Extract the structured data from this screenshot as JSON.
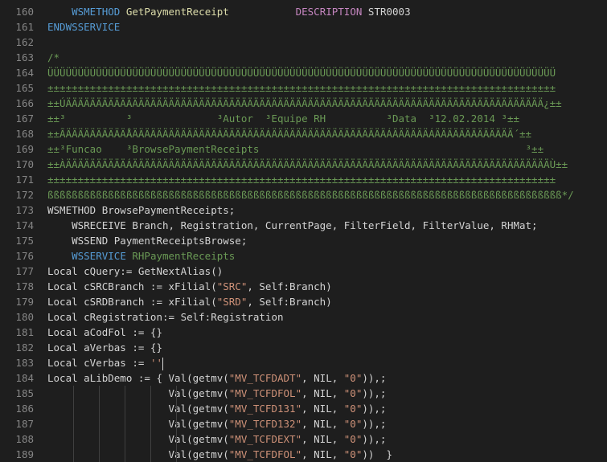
{
  "editor": {
    "colors": {
      "background": "#1e1e1e",
      "line_number": "#858585",
      "keyword": "#569cd6",
      "function": "#dcdcaa",
      "macro": "#c586c0",
      "comment": "#6a9955",
      "string": "#ce9178",
      "number": "#b5cea8",
      "text": "#d4d4d4"
    },
    "lines": [
      {
        "num": "160",
        "tokens": [
          {
            "t": "    ",
            "c": "plain"
          },
          {
            "t": "WSMETHOD",
            "c": "kw"
          },
          {
            "t": " ",
            "c": "plain"
          },
          {
            "t": "GetPaymentReceipt",
            "c": "fn"
          },
          {
            "t": "           ",
            "c": "plain"
          },
          {
            "t": "DESCRIPTION",
            "c": "macro"
          },
          {
            "t": " STR0003",
            "c": "plain"
          }
        ]
      },
      {
        "num": "161",
        "tokens": [
          {
            "t": "ENDWSSERVICE",
            "c": "kw"
          }
        ]
      },
      {
        "num": "162",
        "tokens": []
      },
      {
        "num": "163",
        "tokens": [
          {
            "t": "/*",
            "c": "cm"
          }
        ]
      },
      {
        "num": "164",
        "tokens": [
          {
            "t": "ÜÜÜÜÜÜÜÜÜÜÜÜÜÜÜÜÜÜÜÜÜÜÜÜÜÜÜÜÜÜÜÜÜÜÜÜÜÜÜÜÜÜÜÜÜÜÜÜÜÜÜÜÜÜÜÜÜÜÜÜÜÜÜÜÜÜÜÜÜÜÜÜÜÜÜÜÜÜÜÜÜÜÜÜ",
            "c": "cm"
          }
        ]
      },
      {
        "num": "165",
        "tokens": [
          {
            "t": "±±±±±±±±±±±±±±±±±±±±±±±±±±±±±±±±±±±±±±±±±±±±±±±±±±±±±±±±±±±±±±±±±±±±±±±±±±±±±±±±±±±±",
            "c": "cm"
          }
        ]
      },
      {
        "num": "166",
        "tokens": [
          {
            "t": "±±ÚÄÄÄÄÄÄÄÄÄÄÄÄÄÄÄÄÄÄÄÄÄÄÄÄÄÄÄÄÄÄÄÄÄÄÄÄÄÄÄÄÄÄÄÄÄÄÄÄÄÄÄÄÄÄÄÄÄÄÄÄÄÄÄÄÄÄÄÄÄÄÄÄÄÄÄÄÄÄÄ¿±±",
            "c": "cm"
          }
        ]
      },
      {
        "num": "167",
        "tokens": [
          {
            "t": "±±³          ³              ³Autor  ³Equipe RH          ³Data  ³12.02.2014 ³±±",
            "c": "cm"
          }
        ]
      },
      {
        "num": "168",
        "tokens": [
          {
            "t": "±±ÃÄÄÄÄÄÄÄÄÄÄÅÄÄÄÄÄÄÄÄÄÄÄÄÄÄÁÄÄÄÄÄÄÄÁÄÄÄÄÄÄÄÄÄÄÄÄÄÄÄÄÄÄÄÁÄÄÄÄÄÄÁÄÄÄÄÄÄÄÄÄÄÄÄÄ´±±",
            "c": "cm"
          }
        ]
      },
      {
        "num": "169",
        "tokens": [
          {
            "t": "±±³Funcao    ³BrowsePaymentReceipts                                            ³±±",
            "c": "cm"
          }
        ]
      },
      {
        "num": "170",
        "tokens": [
          {
            "t": "±±ÀÄÄÄÄÄÄÄÄÄÄÁÄÄÄÄÄÄÄÄÄÄÄÄÄÄÄÄÄÄÄÄÄÄÄÄÄÄÄÄÄÄÄÄÄÄÄÄÄÄÄÄÄÄÄÄÄÄÄÄÄÄÄÄÄÄÄÄÄÄÄÄÄÄÄÄÄÄÄÄÄÙ±±",
            "c": "cm"
          }
        ]
      },
      {
        "num": "171",
        "tokens": [
          {
            "t": "±±±±±±±±±±±±±±±±±±±±±±±±±±±±±±±±±±±±±±±±±±±±±±±±±±±±±±±±±±±±±±±±±±±±±±±±±±±±±±±±±±±±",
            "c": "cm"
          }
        ]
      },
      {
        "num": "172",
        "tokens": [
          {
            "t": "ßßßßßßßßßßßßßßßßßßßßßßßßßßßßßßßßßßßßßßßßßßßßßßßßßßßßßßßßßßßßßßßßßßßßßßßßßßßßßßßßßßßßß*/",
            "c": "cm"
          }
        ]
      },
      {
        "num": "173",
        "tokens": [
          {
            "t": "WSMETHOD BrowsePaymentReceipts;",
            "c": "plain"
          }
        ]
      },
      {
        "num": "174",
        "tokens": [
          {
            "t": "    WSRECEIVE Branch, Registration, CurrentPage, FilterField, FilterValue, RHMat;",
            "c": "plain"
          }
        ]
      },
      {
        "num": "175",
        "tokens": [
          {
            "t": "    WSSEND PaymentReceiptsBrowse;",
            "c": "plain"
          }
        ]
      },
      {
        "num": "176",
        "tokens": [
          {
            "t": "    ",
            "c": "plain"
          },
          {
            "t": "WSSERVICE",
            "c": "kw"
          },
          {
            "t": " ",
            "c": "plain"
          },
          {
            "t": "RHPaymentReceipts",
            "c": "cm"
          }
        ]
      },
      {
        "num": "177",
        "tokens": [
          {
            "t": "Local cQuery:= GetNextAlias()",
            "c": "plain"
          }
        ]
      },
      {
        "num": "178",
        "tokens": [
          {
            "t": "Local cSRCBranch := xFilial(",
            "c": "plain"
          },
          {
            "t": "\"SRC\"",
            "c": "str"
          },
          {
            "t": ", Self:Branch)",
            "c": "plain"
          }
        ]
      },
      {
        "num": "179",
        "tokens": [
          {
            "t": "Local cSRDBranch := xFilial(",
            "c": "plain"
          },
          {
            "t": "\"SRD\"",
            "c": "str"
          },
          {
            "t": ", Self:Branch)",
            "c": "plain"
          }
        ]
      },
      {
        "num": "180",
        "tokens": [
          {
            "t": "Local cRegistration:= Self:Registration",
            "c": "plain"
          }
        ]
      },
      {
        "num": "181",
        "tokens": [
          {
            "t": "Local aCodFol := {}",
            "c": "plain"
          }
        ]
      },
      {
        "num": "182",
        "tokens": [
          {
            "t": "Local aVerbas := {}",
            "c": "plain"
          }
        ]
      },
      {
        "num": "183",
        "tokens": [
          {
            "t": "Local cVerbas := ",
            "c": "plain"
          },
          {
            "t": "''",
            "c": "str"
          }
        ],
        "cursor": true
      },
      {
        "num": "184",
        "tokens": [
          {
            "t": "Local aLibDemo := { Val(getmv(",
            "c": "plain"
          },
          {
            "t": "\"MV_TCFDADT\"",
            "c": "str"
          },
          {
            "t": ", NIL, ",
            "c": "plain"
          },
          {
            "t": "\"0\"",
            "c": "str"
          },
          {
            "t": ")),;",
            "c": "plain"
          }
        ]
      },
      {
        "num": "185",
        "tokens": [
          {
            "t": "                    Val(getmv(",
            "c": "plain"
          },
          {
            "t": "\"MV_TCFDFOL\"",
            "c": "str"
          },
          {
            "t": ", NIL, ",
            "c": "plain"
          },
          {
            "t": "\"0\"",
            "c": "str"
          },
          {
            "t": ")),;",
            "c": "plain"
          }
        ]
      },
      {
        "num": "186",
        "tokens": [
          {
            "t": "                    Val(getmv(",
            "c": "plain"
          },
          {
            "t": "\"MV_TCFD131\"",
            "c": "str"
          },
          {
            "t": ", NIL, ",
            "c": "plain"
          },
          {
            "t": "\"0\"",
            "c": "str"
          },
          {
            "t": ")),;",
            "c": "plain"
          }
        ]
      },
      {
        "num": "187",
        "tokens": [
          {
            "t": "                    Val(getmv(",
            "c": "plain"
          },
          {
            "t": "\"MV_TCFD132\"",
            "c": "str"
          },
          {
            "t": ", NIL, ",
            "c": "plain"
          },
          {
            "t": "\"0\"",
            "c": "str"
          },
          {
            "t": ")),;",
            "c": "plain"
          }
        ]
      },
      {
        "num": "188",
        "tokens": [
          {
            "t": "                    Val(getmv(",
            "c": "plain"
          },
          {
            "t": "\"MV_TCFDEXT\"",
            "c": "str"
          },
          {
            "t": ", NIL, ",
            "c": "plain"
          },
          {
            "t": "\"0\"",
            "c": "str"
          },
          {
            "t": ")),;",
            "c": "plain"
          }
        ]
      },
      {
        "num": "189",
        "tokens": [
          {
            "t": "                    Val(getmv(",
            "c": "plain"
          },
          {
            "t": "\"MV_TCFDFOL\"",
            "c": "str"
          },
          {
            "t": ", NIL, ",
            "c": "plain"
          },
          {
            "t": "\"0\"",
            "c": "str"
          },
          {
            "t": "))  }",
            "c": "plain"
          }
        ]
      }
    ]
  }
}
